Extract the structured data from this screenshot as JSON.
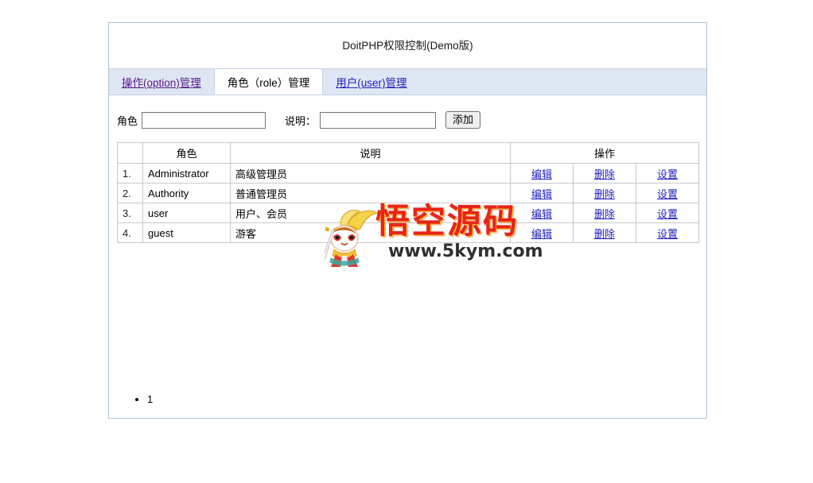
{
  "app": {
    "title": "DoitPHP权限控制(Demo版)"
  },
  "tabs": [
    {
      "label": "操作(option)管理",
      "active": false,
      "visited": true
    },
    {
      "label": "角色（role）管理",
      "active": true,
      "visited": false
    },
    {
      "label": "用户(user)管理",
      "active": false,
      "visited": false
    }
  ],
  "add_form": {
    "role_label": "角色",
    "role_value": "",
    "role_placeholder": "",
    "desc_label": "说明：",
    "desc_value": "",
    "desc_placeholder": "",
    "submit_label": "添加"
  },
  "table": {
    "headers": {
      "index": "",
      "role": "角色",
      "description": "说明",
      "actions": "操作"
    },
    "rows": [
      {
        "index": "1.",
        "role": "Administrator",
        "description": "高级管理员",
        "edit": "编辑",
        "delete": "删除",
        "settings": "设置"
      },
      {
        "index": "2.",
        "role": "Authority",
        "description": "普通管理员",
        "edit": "编辑",
        "delete": "删除",
        "settings": "设置"
      },
      {
        "index": "3.",
        "role": "user",
        "description": "用户、会员",
        "edit": "编辑",
        "delete": "删除",
        "settings": "设置"
      },
      {
        "index": "4.",
        "role": "guest",
        "description": "游客",
        "edit": "编辑",
        "delete": "删除",
        "settings": "设置"
      }
    ]
  },
  "pagination": {
    "items": [
      "1"
    ]
  },
  "watermark": {
    "text": "悟空源码",
    "url": "www.5kym.com"
  },
  "colors": {
    "frame_border": "#aec3d4",
    "tab_bar_bg": "#dfe6f3",
    "link_blue": "#2020c0",
    "link_visited": "#551a8b",
    "table_border": "#c9c9c9",
    "watermark_red": "#e8241a"
  }
}
